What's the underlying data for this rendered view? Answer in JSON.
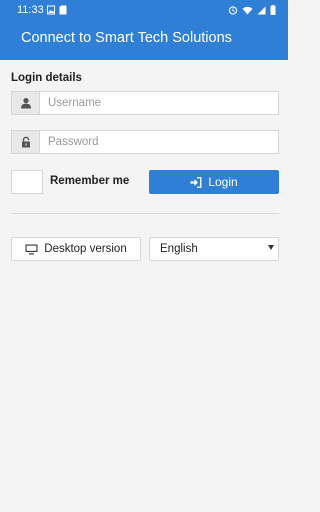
{
  "status_bar": {
    "time": "11:33",
    "left_icons": [
      "photo-icon",
      "sd-card-icon"
    ],
    "right_icons": [
      "alarm-icon",
      "wifi-icon",
      "signal-icon",
      "battery-icon"
    ]
  },
  "app_bar": {
    "title": "Connect to Smart Tech Solutions"
  },
  "login": {
    "section_label": "Login details",
    "username_placeholder": "Username",
    "password_placeholder": "Password",
    "remember_label": "Remember me",
    "login_label": "Login"
  },
  "footer": {
    "desktop_label": "Desktop version",
    "language_selected": "English"
  },
  "colors": {
    "accent": "#2f7fd6",
    "background": "#f4f4f4"
  }
}
